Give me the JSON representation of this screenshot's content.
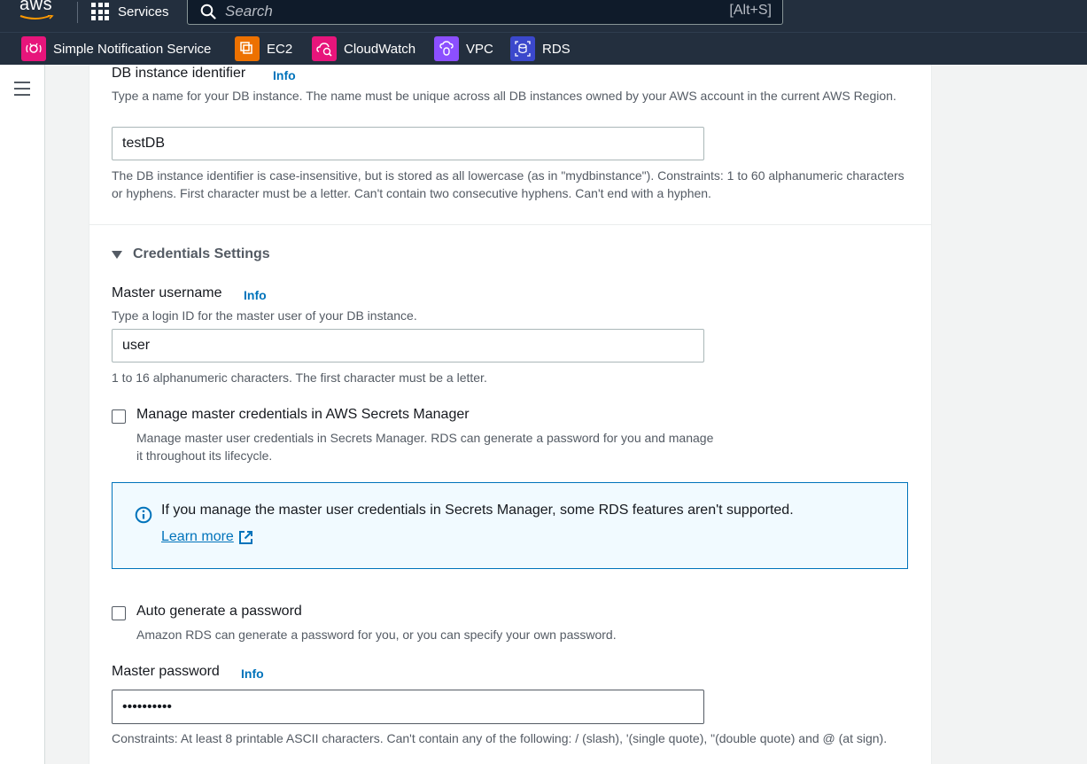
{
  "topnav": {
    "logo_text": "aws",
    "services_label": "Services",
    "search_placeholder": "Search",
    "search_shortcut": "[Alt+S]"
  },
  "favorites": [
    {
      "label": "Simple Notification Service",
      "icon": "sns-icon",
      "color": "#e7157b"
    },
    {
      "label": "EC2",
      "icon": "ec2-icon",
      "color": "#ed7100"
    },
    {
      "label": "CloudWatch",
      "icon": "cloudwatch-icon",
      "color": "#e7157b"
    },
    {
      "label": "VPC",
      "icon": "vpc-icon",
      "color": "#8c4fff"
    },
    {
      "label": "RDS",
      "icon": "rds-icon",
      "color": "#3b48cc"
    }
  ],
  "form": {
    "db_identifier": {
      "label": "DB instance identifier",
      "info": "Info",
      "description": "Type a name for your DB instance. The name must be unique across all DB instances owned by your AWS account in the current AWS Region.",
      "value": "testDB",
      "constraint": "The DB instance identifier is case-insensitive, but is stored as all lowercase (as in \"mydbinstance\"). Constraints: 1 to 60 alphanumeric characters or hyphens. First character must be a letter. Can't contain two consecutive hyphens. Can't end with a hyphen."
    },
    "credentials": {
      "section_title": "Credentials Settings",
      "master_username": {
        "label": "Master username",
        "info": "Info",
        "description": "Type a login ID for the master user of your DB instance.",
        "value": "user",
        "constraint": "1 to 16 alphanumeric characters. The first character must be a letter."
      },
      "secrets_manager": {
        "label": "Manage master credentials in AWS Secrets Manager",
        "description": "Manage master user credentials in Secrets Manager. RDS can generate a password for you and manage it throughout its lifecycle."
      },
      "alert": {
        "message": "If you manage the master user credentials in Secrets Manager, some RDS features aren't supported.",
        "link": "Learn more"
      },
      "auto_password": {
        "label": "Auto generate a password",
        "description": "Amazon RDS can generate a password for you, or you can specify your own password."
      },
      "master_password": {
        "label": "Master password",
        "info": "Info",
        "value": "••••••••••",
        "constraint": "Constraints: At least 8 printable ASCII characters. Can't contain any of the following: / (slash), '(single quote), \"(double quote) and @ (at sign)."
      }
    }
  }
}
